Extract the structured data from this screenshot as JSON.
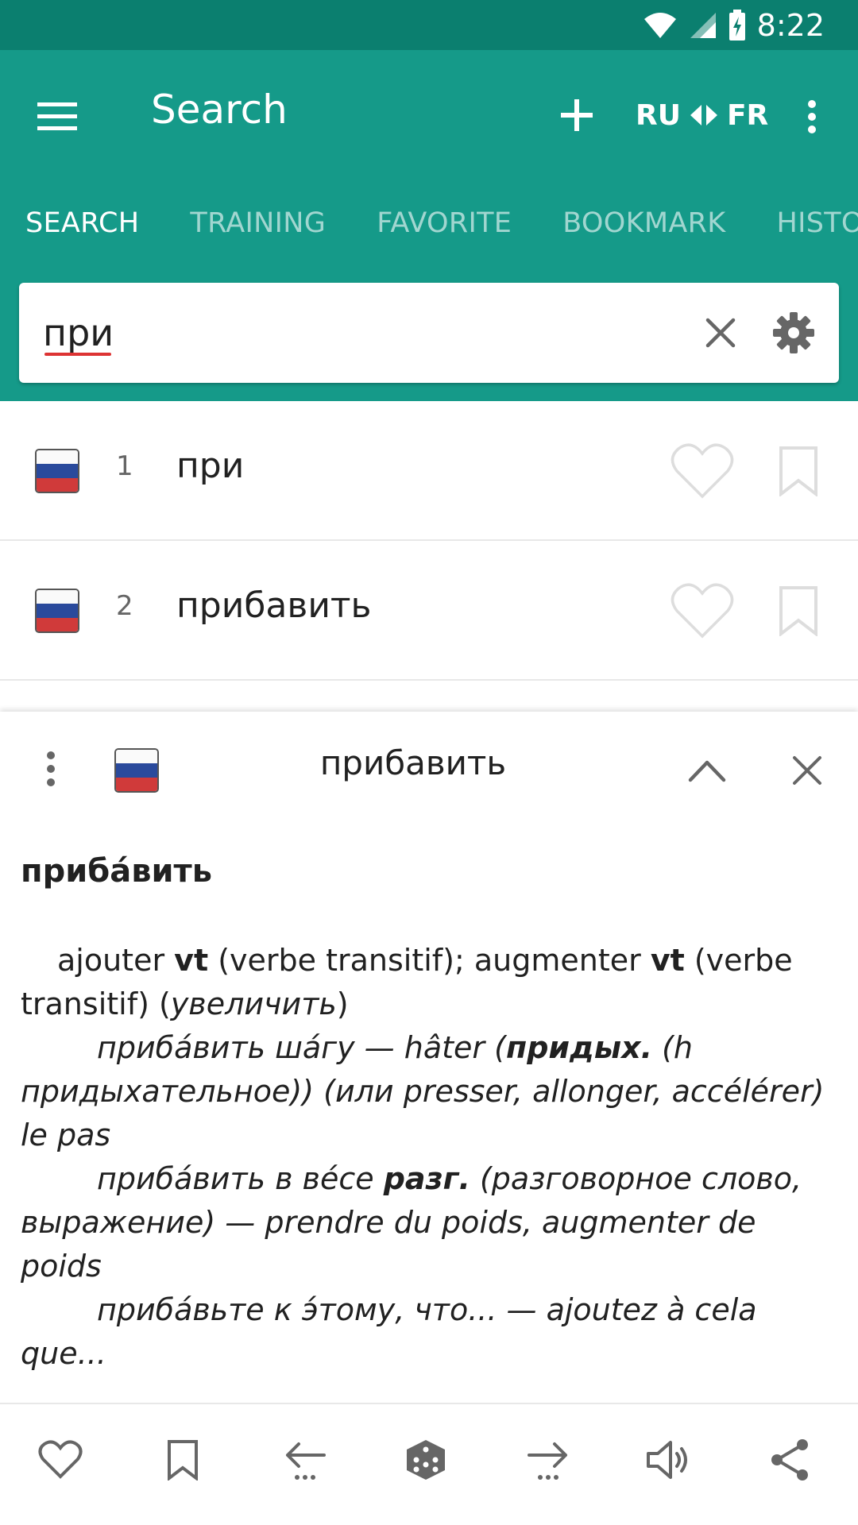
{
  "status_bar": {
    "time": "8:22"
  },
  "app_bar": {
    "title": "Search",
    "lang_from": "RU",
    "lang_to": "FR"
  },
  "tabs": [
    {
      "label": "SEARCH"
    },
    {
      "label": "TRAINING"
    },
    {
      "label": "FAVORITE"
    },
    {
      "label": "BOOKMARK"
    },
    {
      "label": "HISTORY"
    }
  ],
  "search": {
    "value": "при",
    "placeholder": ""
  },
  "results": [
    {
      "num": "1",
      "word": "при"
    },
    {
      "num": "2",
      "word": "прибавить"
    }
  ],
  "detail": {
    "title": "прибавить",
    "headword": "прибáвить",
    "line1": {
      "a": "ajouter ",
      "b": "vt",
      "c": " (verbe transitif); augmenter ",
      "d": "vt",
      "e": " (verbe transitif) (",
      "f": "увеличить",
      "g": ")"
    },
    "ex1": {
      "a": "прибáвить шáгу — hâter (",
      "b": "придых.",
      "c": " (h придыхательное)) (или presser, allonger, accélérer) le pas"
    },
    "ex2": {
      "a": "прибáвить в вéсе ",
      "b": "разг.",
      "c": " (разговорное слово, выражение) — prendre du poids, augmenter de poids"
    },
    "ex3": {
      "a": "прибáвьте к э́тому, что... — ajoutez à cela que..."
    }
  },
  "icons": {
    "accent": "#159a89",
    "status_bar_color": "#0b7f6f"
  }
}
